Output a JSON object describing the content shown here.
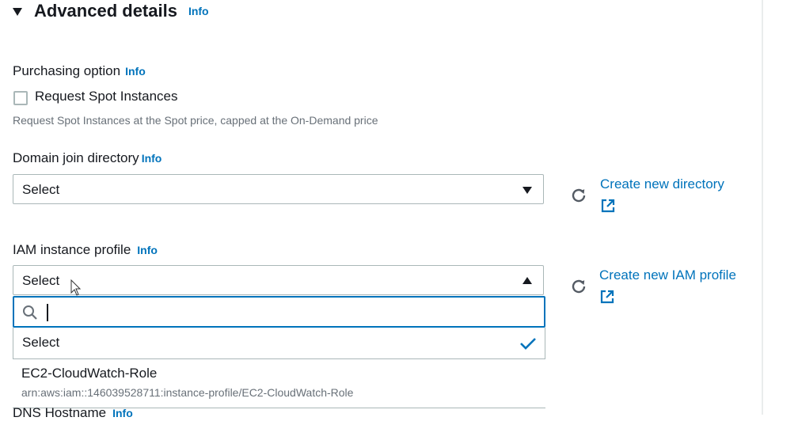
{
  "advanced": {
    "title": "Advanced details",
    "info": "Info"
  },
  "purchasing": {
    "label": "Purchasing option",
    "info": "Info",
    "checkbox_label": "Request Spot Instances",
    "description": "Request Spot Instances at the Spot price, capped at the On-Demand price"
  },
  "domain": {
    "label": "Domain join directory",
    "info": "Info",
    "select_value": "Select",
    "create_link": "Create new directory"
  },
  "iam": {
    "label": "IAM instance profile",
    "info": "Info",
    "select_value": "Select",
    "create_link": "Create new IAM profile",
    "search_value": "",
    "options": [
      {
        "label": "Select",
        "selected": true
      },
      {
        "label": "EC2-CloudWatch-Role",
        "arn": "arn:aws:iam::146039528711:instance-profile/EC2-CloudWatch-Role"
      }
    ]
  },
  "dns": {
    "label": "DNS Hostname",
    "info": "Info"
  },
  "colors": {
    "accent": "#0073bb",
    "text": "#16191f",
    "muted": "#687078",
    "border": "#aab7b8"
  },
  "icons": [
    "caret-down-icon",
    "refresh-icon",
    "external-link-icon",
    "search-icon",
    "check-icon",
    "caret-up-icon"
  ]
}
